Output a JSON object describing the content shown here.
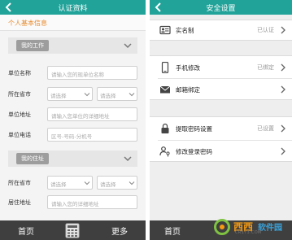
{
  "left": {
    "header_title": "认证资料",
    "section_title": "个人基本信息",
    "work_group": {
      "title": "我的工作",
      "rows": [
        {
          "label": "单位名称",
          "placeholder": "请输入您的现单位名称"
        },
        {
          "label": "所在省市",
          "province": "请选择",
          "city": "请选择"
        },
        {
          "label": "单位地址",
          "placeholder": "请输入您单位的详细地址"
        },
        {
          "label": "单位电话",
          "placeholder": "区号-号码-分机号"
        }
      ]
    },
    "home_group": {
      "title": "我的住址",
      "rows": [
        {
          "label": "所在省市",
          "province": "请选择",
          "city": "请选择"
        },
        {
          "label": "居住地址",
          "placeholder": "请输入您的详细地址"
        }
      ]
    },
    "bottom_nav": {
      "home": "首页",
      "more": "更多",
      "calculator_icon": "calculator-icon"
    }
  },
  "right": {
    "header_title": "安全设置",
    "items": [
      {
        "label": "实名制",
        "status": "已认证",
        "icon": "id-card-icon"
      },
      {
        "label": "手机修改",
        "status": "已绑定",
        "icon": "phone-icon"
      },
      {
        "label": "邮箱绑定",
        "status": "",
        "icon": "mail-icon"
      },
      {
        "label": "提取密码设置",
        "status": "已设置",
        "icon": "lock-icon"
      },
      {
        "label": "修改登录密码",
        "status": "",
        "icon": "user-key-icon"
      }
    ],
    "bottom_nav": {
      "home": "首页"
    }
  },
  "watermark": {
    "cn1": "西西",
    "cn2": "软件园",
    "en": "CR173.COM"
  },
  "colors": {
    "accent": "#21a39a",
    "orange": "#e88a2c",
    "nav_bg": "#3f3f3f"
  }
}
